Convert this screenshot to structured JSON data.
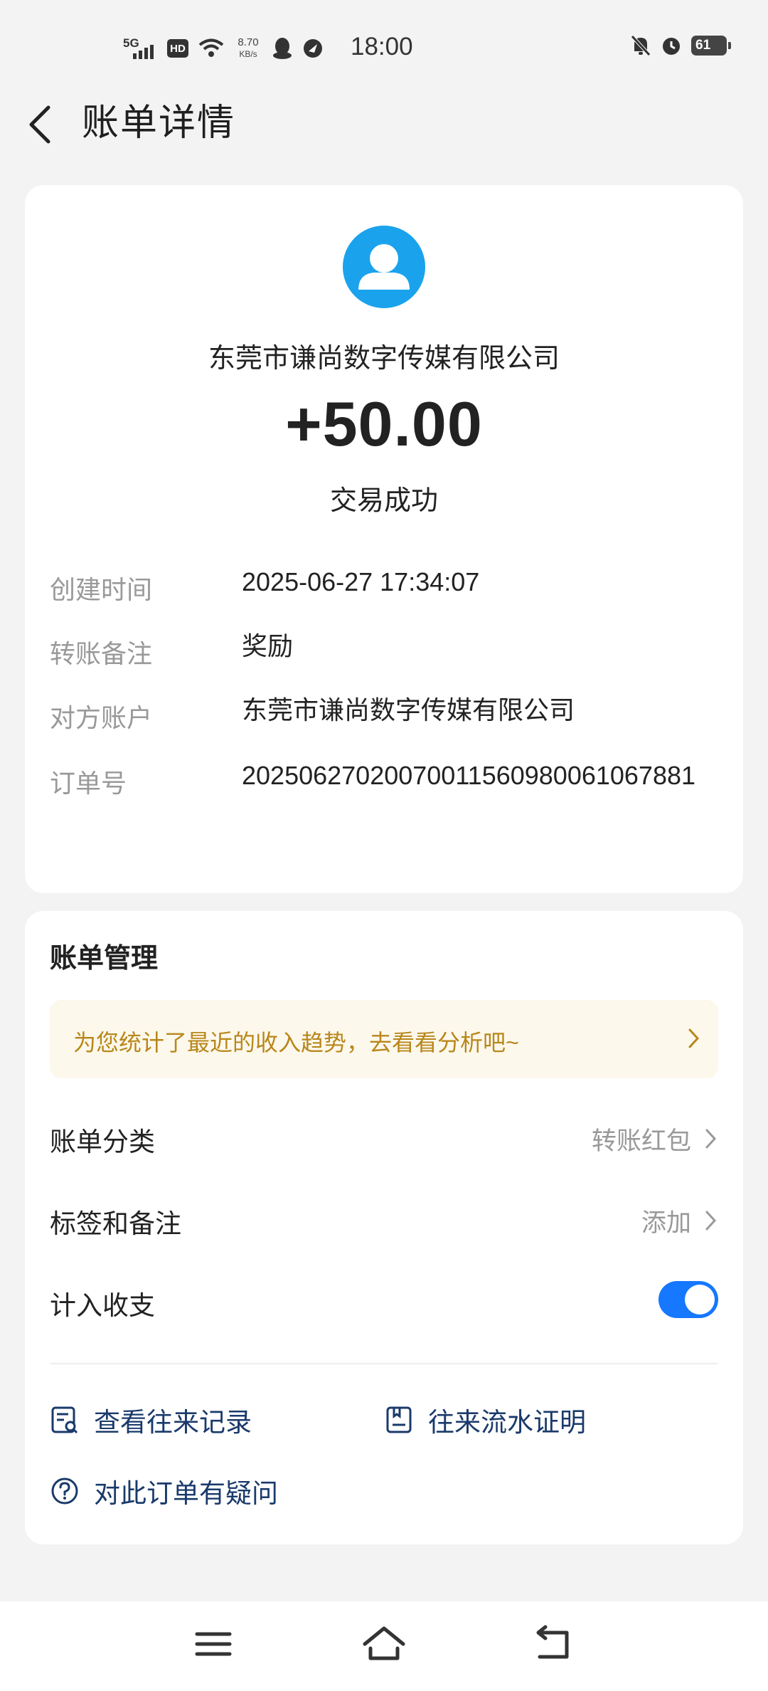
{
  "status_bar": {
    "network": "5G",
    "hd": "HD",
    "speed_value": "8.70",
    "speed_unit": "KB/s",
    "time": "18:00",
    "battery": "61"
  },
  "header": {
    "title": "账单详情"
  },
  "transaction": {
    "payee": "东莞市谦尚数字传媒有限公司",
    "amount": "+50.00",
    "status": "交易成功",
    "rows": [
      {
        "label": "创建时间",
        "value": "2025-06-27 17:34:07"
      },
      {
        "label": "转账备注",
        "value": "奖励"
      },
      {
        "label": "对方账户",
        "value": "东莞市谦尚数字传媒有限公司"
      },
      {
        "label": "订单号",
        "value": "20250627020070011560980061067881"
      }
    ]
  },
  "management": {
    "title": "账单管理",
    "promo": "为您统计了最近的收入趋势，去看看分析吧~",
    "category": {
      "label": "账单分类",
      "value": "转账红包"
    },
    "tags": {
      "label": "标签和备注",
      "value": "添加"
    },
    "include": {
      "label": "计入收支",
      "enabled": true
    },
    "links": {
      "records": "查看往来记录",
      "proof": "往来流水证明",
      "question": "对此订单有疑问"
    }
  },
  "colors": {
    "accent": "#1677ff",
    "avatar": "#1aa3ec",
    "promo_text": "#b8871b",
    "link": "#1a3a6b"
  }
}
